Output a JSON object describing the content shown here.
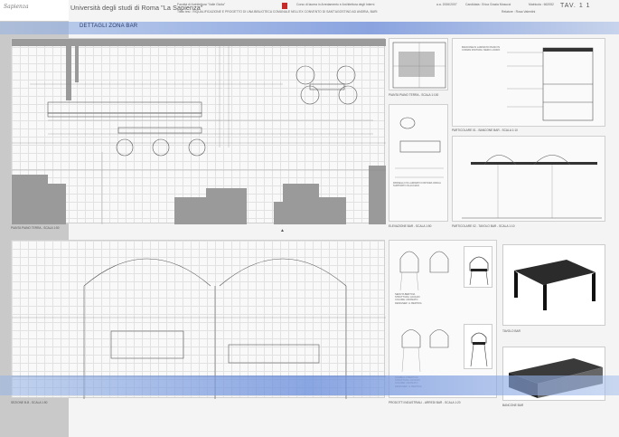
{
  "header": {
    "university": "Università degli studi di Roma \"La Sapienza\"",
    "faculty": "Facoltà di Architettura \"Valle Giulia\"",
    "course": "Corso di laurea in Arredamento e Architettura degli Interni",
    "thesis": "Titolo tesi : RIQUALIFICAZIONE E PROGETTO DI UNA BIBLIOTECA COMUNALE NELL'EX CONVENTO DI SANT'AGOSTINO AD ANDRIA, BARI",
    "academic_year": "a.a. 2006/2007",
    "candidate": "Candidata : Erica Grazia Mosucci",
    "matricola": "Matricola : 662052",
    "relatore": "Relatore : Rosa Valentini",
    "table_number": "TAV. 1 1",
    "logo": "Sapienza"
  },
  "section_title": "DETTAGLI ZONA BAR",
  "captions": {
    "plan": "PIANTA PIANO TERRA - SCALA 1:50",
    "plan_small": "PIANTA PIANO TERRA - SCALA 1:100",
    "elev_bar": "ELEVAZIONE BAR - SCALA 1:50",
    "detail1": "PARTICOLARE 01 - BANCONE BAR - SCALA 1:10",
    "detail2": "PARTICOLARE 02 - TAVOLO BAR - SCALA 1:10",
    "section": "SEZIONE B-B - SCALA 1:50",
    "furniture": "PRODOTTI INDUSTRIALI - ARREDI BAR - SCALA 1:20",
    "table_render": "TAVOLO BAR",
    "counter_render": "BANCONE BAR"
  },
  "notes": {
    "chair1": "SEDUTA BERTOIA\nSTRUTTURA: ACCIAIO\nCOLORE: CROMATO\nDESIGNER: H. BERTOIA",
    "chair2": "SGABELLO BERTOIA\nSTRUTTURA: ACCIAIO\nCOLORE: CROMATO\nDESIGNER: H. BERTOIA",
    "counter": "BANCONE IN LAMINATO\nPIANO IN CORIAN\nFINITURA: NERO LUCIDO",
    "elev": "PANNELLO IN LAMINATO\nFINITURA OPACA\nSUPPORTO IN ACCIAIO"
  }
}
